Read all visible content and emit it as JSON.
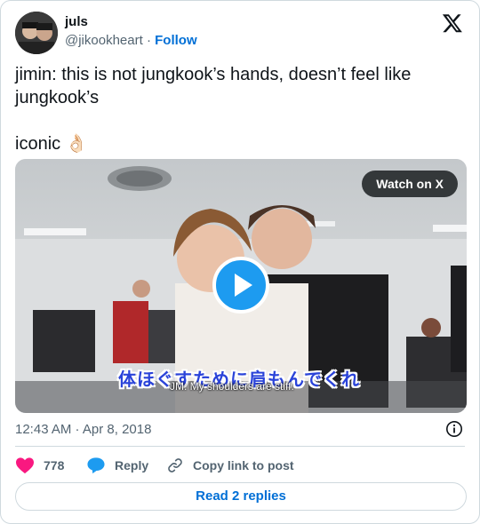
{
  "author": {
    "name": "juls",
    "handle": "@jikookheart",
    "separator": "·",
    "follow_label": "Follow"
  },
  "tweet": {
    "text": "jimin: this is not jungkook’s hands, doesn’t feel like jungkook’s\n\niconic 👌🏻"
  },
  "media": {
    "watch_label": "Watch on X",
    "subtitle_jp": "体ほぐすために肩もんでくれ",
    "subtitle_en": "JM: My shoulders are stiff."
  },
  "timestamp": "12:43 AM · Apr 8, 2018",
  "actions": {
    "like_count": "778",
    "reply_label": "Reply",
    "copy_label": "Copy link to post"
  },
  "read_replies_label": "Read 2 replies",
  "colors": {
    "accent_blue": "#1d9bf0",
    "link_blue": "#006fd6",
    "like_pink": "#f91880",
    "muted_text": "#536471"
  },
  "icons": [
    "x-logo-icon",
    "info-icon",
    "heart-icon",
    "reply-bubble-icon",
    "link-icon",
    "play-icon"
  ]
}
